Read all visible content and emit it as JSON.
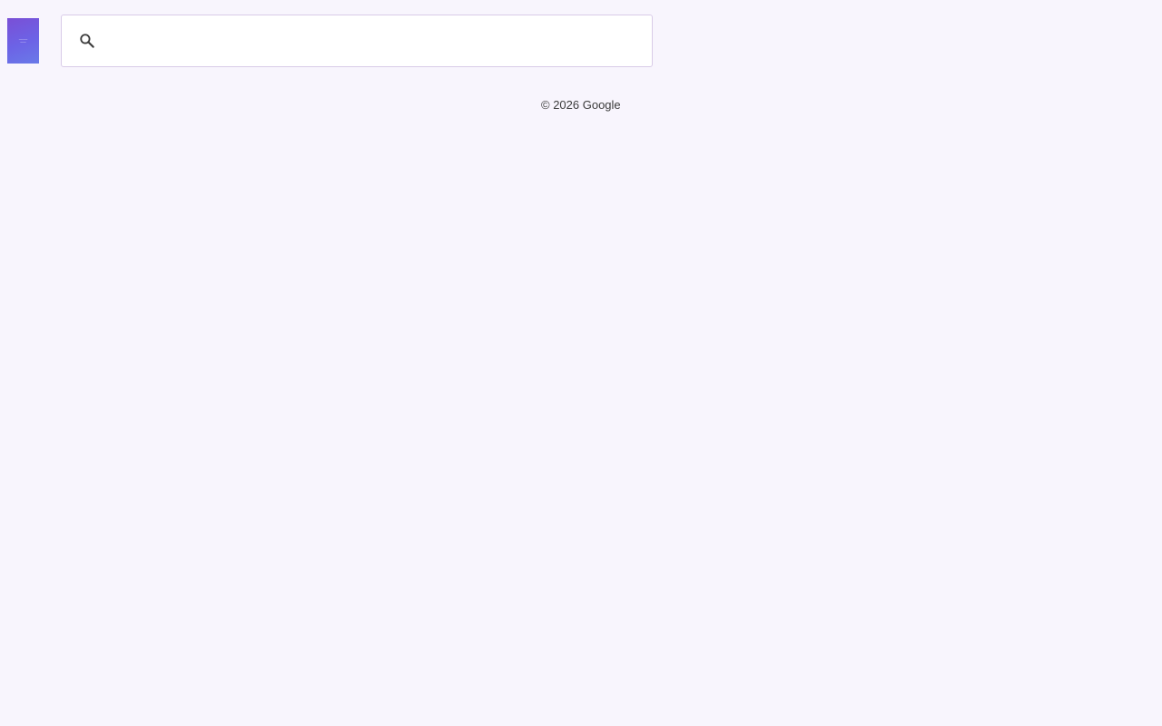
{
  "thumbnail": {
    "icon": "cover-thumbnail-image"
  },
  "search": {
    "icon": "search-icon",
    "value": "",
    "placeholder": ""
  },
  "footer": {
    "copyright": "© 2026 Google"
  },
  "colors": {
    "background": "#f8f5fd",
    "search_border": "#d9cbe8",
    "thumbnail_gradient_start": "#7a4fd6",
    "thumbnail_gradient_end": "#6a7ae8",
    "text": "#3c3c3c"
  }
}
